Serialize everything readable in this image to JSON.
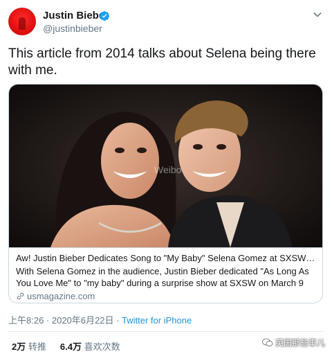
{
  "author": {
    "name": "Justin Bieber",
    "handle": "@justinbieber"
  },
  "tweet": {
    "text": "This article from 2014 talks about Selena being there with me."
  },
  "card": {
    "image_watermark": "Weibo",
    "title": "Aw! Justin Bieber Dedicates Song to \"My Baby\" Selena Gomez at SXSW Sh...",
    "description": "With Selena Gomez in the audience, Justin Bieber dedicated \"As Long As You Love Me\" to \"my baby\" during a surprise show at SXSW on March 9",
    "domain": "usmagazine.com"
  },
  "meta": {
    "time": "上午8:26 · 2020年6月22日 · ",
    "source": "Twitter for iPhone"
  },
  "stats": {
    "retweets_count": "2万",
    "retweets_label": "转推",
    "likes_count": "6.4万",
    "likes_label": "喜欢次数"
  },
  "watermark": {
    "text": "英国那些事儿"
  },
  "colors": {
    "accent": "#1b95e0",
    "verified": "#1da1f2",
    "muted": "#657786",
    "avatar": "#e01010"
  }
}
